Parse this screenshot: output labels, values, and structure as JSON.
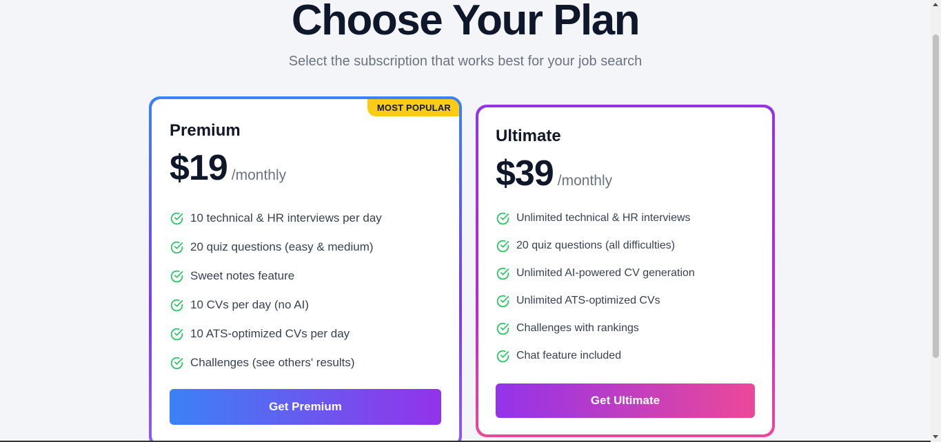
{
  "header": {
    "title": "Choose Your Plan",
    "subtitle": "Select the subscription that works best for your job search"
  },
  "plans": [
    {
      "name": "Premium",
      "badge": "MOST POPULAR",
      "price": "$19",
      "period": "/monthly",
      "features": [
        "10 technical & HR interviews per day",
        "20 quiz questions (easy & medium)",
        "Sweet notes feature",
        "10 CVs per day (no AI)",
        "10 ATS-optimized CVs per day",
        "Challenges (see others' results)"
      ],
      "cta": "Get Premium",
      "accent_from": "#3b82f6",
      "accent_to": "#9333ea"
    },
    {
      "name": "Ultimate",
      "price": "$39",
      "period": "/monthly",
      "features": [
        "Unlimited technical & HR interviews",
        "20 quiz questions (all difficulties)",
        "Unlimited AI-powered CV generation",
        "Unlimited ATS-optimized CVs",
        "Challenges with rankings",
        "Chat feature included"
      ],
      "cta": "Get Ultimate",
      "accent_from": "#9333ea",
      "accent_to": "#ec4899"
    }
  ],
  "colors": {
    "check": "#22c55e",
    "badge": "#facc15",
    "background": "#f3f5f9"
  },
  "icons": {
    "feature_icon": "check-circle-icon"
  }
}
